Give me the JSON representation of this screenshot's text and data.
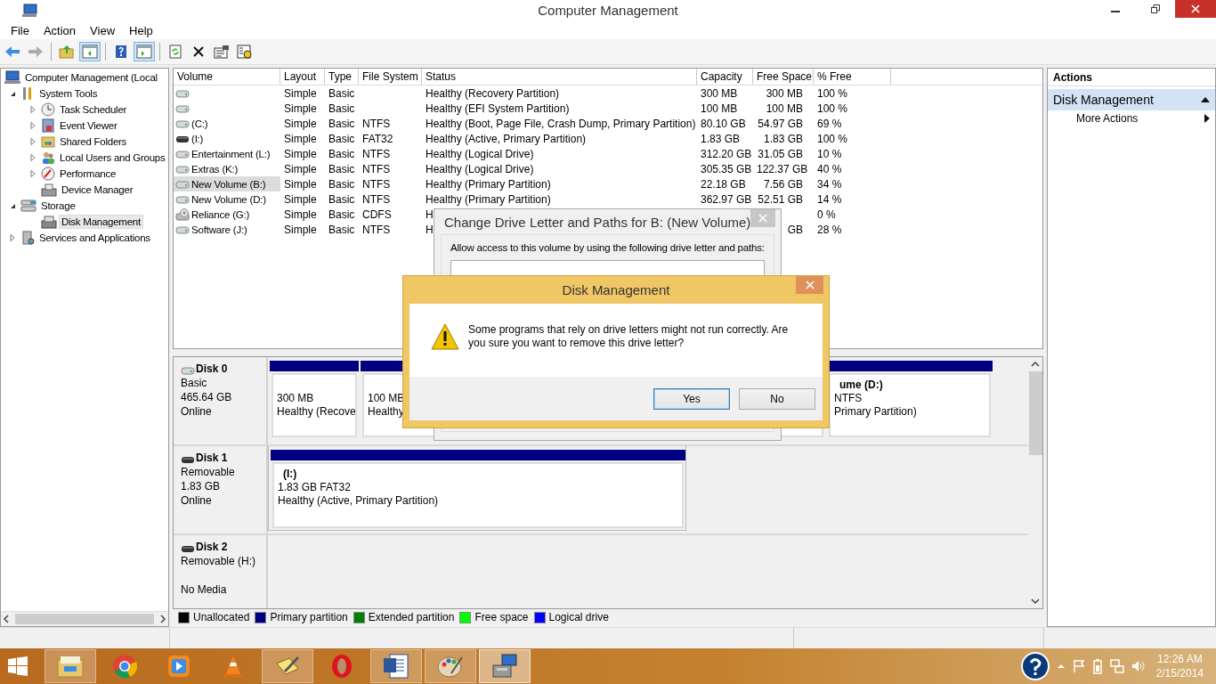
{
  "window": {
    "title": "Computer Management"
  },
  "menu": [
    "File",
    "Action",
    "View",
    "Help"
  ],
  "toolbar": [
    {
      "pressed": false,
      "disabled": false
    },
    {
      "pressed": false,
      "disabled": true
    },
    {
      "pressed": false,
      "disabled": false
    },
    {
      "pressed": true,
      "disabled": false
    },
    {
      "pressed": false,
      "disabled": false
    },
    {
      "pressed": true,
      "disabled": false
    },
    {
      "pressed": false,
      "disabled": false
    },
    {
      "pressed": false,
      "disabled": false
    },
    {
      "pressed": false,
      "disabled": false
    },
    {
      "pressed": false,
      "disabled": false
    }
  ],
  "tree": [
    {
      "label": "Computer Management (Local",
      "selected": false,
      "children": [
        {
          "label": "System Tools",
          "expanded": true,
          "selected": false,
          "children": [
            {
              "label": "Task Scheduler",
              "expanded": false,
              "selected": false
            },
            {
              "label": "Event Viewer",
              "expanded": false,
              "selected": false
            },
            {
              "label": "Shared Folders",
              "expanded": false,
              "selected": false
            },
            {
              "label": "Local Users and Groups",
              "expanded": false,
              "selected": false
            },
            {
              "label": "Performance",
              "expanded": false,
              "selected": false
            },
            {
              "label": "Device Manager",
              "selected": false
            }
          ]
        },
        {
          "label": "Storage",
          "expanded": true,
          "selected": false,
          "children": [
            {
              "label": "Disk Management",
              "selected": true
            }
          ]
        },
        {
          "label": "Services and Applications",
          "expanded": false,
          "selected": false
        }
      ]
    }
  ],
  "volumes": {
    "columns": [
      "Volume",
      "Layout",
      "Type",
      "File System",
      "Status",
      "Capacity",
      "Free Space",
      "% Free"
    ],
    "rows": [
      {
        "kind": "disk",
        "selected": false,
        "layout": "Simple",
        "type": "Basic",
        "status": "Healthy (Recovery Partition)",
        "capacity": "300 MB",
        "free_space": "300 MB",
        "percent_free": "100 %"
      },
      {
        "kind": "disk",
        "selected": false,
        "layout": "Simple",
        "type": "Basic",
        "status": "Healthy (EFI System Partition)",
        "capacity": "100 MB",
        "free_space": "100 MB",
        "percent_free": "100 %"
      },
      {
        "kind": "disk",
        "selected": false,
        "volume": "(C:)",
        "layout": "Simple",
        "type": "Basic",
        "file_system": "NTFS",
        "status": "Healthy (Boot, Page File, Crash Dump, Primary Partition)",
        "capacity": "80.10 GB",
        "free_space": "54.97 GB",
        "percent_free": "69 %"
      },
      {
        "kind": "removable",
        "selected": false,
        "volume": "(I:)",
        "layout": "Simple",
        "type": "Basic",
        "file_system": "FAT32",
        "status": "Healthy (Active, Primary Partition)",
        "capacity": "1.83 GB",
        "free_space": "1.83 GB",
        "percent_free": "100 %"
      },
      {
        "kind": "disk",
        "selected": false,
        "volume": "Entertainment (L:)",
        "layout": "Simple",
        "type": "Basic",
        "file_system": "NTFS",
        "status": "Healthy (Logical Drive)",
        "capacity": "312.20 GB",
        "free_space": "31.05 GB",
        "percent_free": "10 %"
      },
      {
        "kind": "disk",
        "selected": false,
        "volume": "Extras (K:)",
        "layout": "Simple",
        "type": "Basic",
        "file_system": "NTFS",
        "status": "Healthy (Logical Drive)",
        "capacity": "305.35 GB",
        "free_space": "122.37 GB",
        "percent_free": "40 %"
      },
      {
        "kind": "disk",
        "selected": true,
        "volume": "New Volume (B:)",
        "layout": "Simple",
        "type": "Basic",
        "file_system": "NTFS",
        "status": "Healthy (Primary Partition)",
        "capacity": "22.18 GB",
        "free_space": "7.56 GB",
        "percent_free": "34 %"
      },
      {
        "kind": "disk",
        "selected": false,
        "volume": "New Volume (D:)",
        "layout": "Simple",
        "type": "Basic",
        "file_system": "NTFS",
        "status": "Healthy (Primary Partition)",
        "capacity": "362.97 GB",
        "free_space": "52.51 GB",
        "percent_free": "14 %"
      },
      {
        "kind": "cd",
        "selected": false,
        "volume": "Reliance (G:)",
        "layout": "Simple",
        "type": "Basic",
        "file_system": "CDFS",
        "status": "H",
        "percent_free": "0 %"
      },
      {
        "kind": "disk",
        "selected": false,
        "volume": "Software (J:)",
        "layout": "Simple",
        "type": "Basic",
        "file_system": "NTFS",
        "status": "H",
        "free_space": "GB",
        "percent_free": "28 %"
      }
    ]
  },
  "disks": [
    {
      "name": "Disk 0",
      "kind": "disk",
      "type": "Basic",
      "size": "465.64 GB",
      "state": "Online",
      "partitions": [
        {
          "size": "300 MB",
          "status": "Healthy (Recove",
          "color": "#000080"
        },
        {
          "size": "100 MB",
          "status": "Healthy",
          "color": "#000080"
        },
        {
          "name": "ume  (D:)",
          "size": "NTFS",
          "status": "Primary Partition)",
          "color": "#000080"
        }
      ]
    },
    {
      "name": "Disk 1",
      "kind": "removable",
      "type": "Removable",
      "size": "1.83 GB",
      "state": "Online",
      "partitions": [
        {
          "name": "(I:)",
          "size": "1.83 GB FAT32",
          "status": "Healthy (Active, Primary Partition)",
          "color": "#000080"
        }
      ]
    },
    {
      "name": "Disk 2",
      "kind": "removable",
      "type": "Removable (H:)",
      "state": "No Media"
    }
  ],
  "legend": [
    {
      "label": "Unallocated",
      "color": "#000000"
    },
    {
      "label": "Primary partition",
      "color": "#000080"
    },
    {
      "label": "Extended partition",
      "color": "#008000"
    },
    {
      "label": "Free space",
      "color": "#00ff00"
    },
    {
      "label": "Logical drive",
      "color": "#0000ff"
    }
  ],
  "actions": {
    "title": "Actions",
    "sections": [
      {
        "label": "Disk Management",
        "expanded": true,
        "items": [
          "More Actions"
        ]
      }
    ]
  },
  "paths_dialog": {
    "title": "Change Drive Letter and Paths for B: (New Volume)",
    "label": "Allow access to this volume by using the following drive letter and paths:"
  },
  "confirm_dialog": {
    "title": "Disk Management",
    "message": "Some programs that rely on drive letters might not run correctly. Are you sure you want to remove this drive letter?",
    "buttons": [
      {
        "label": "Yes",
        "default": true
      },
      {
        "label": "No",
        "default": false
      }
    ]
  },
  "taskbar": {
    "apps": [
      {
        "running": true,
        "selected": false
      },
      {
        "running": false,
        "selected": false
      },
      {
        "running": false,
        "selected": false
      },
      {
        "running": false,
        "selected": false
      },
      {
        "running": true,
        "selected": false
      },
      {
        "running": false,
        "selected": false
      },
      {
        "running": true,
        "selected": false
      },
      {
        "running": true,
        "selected": false
      },
      {
        "running": true,
        "selected": true
      }
    ],
    "time": "12:26 AM",
    "date": "2/15/2014"
  }
}
